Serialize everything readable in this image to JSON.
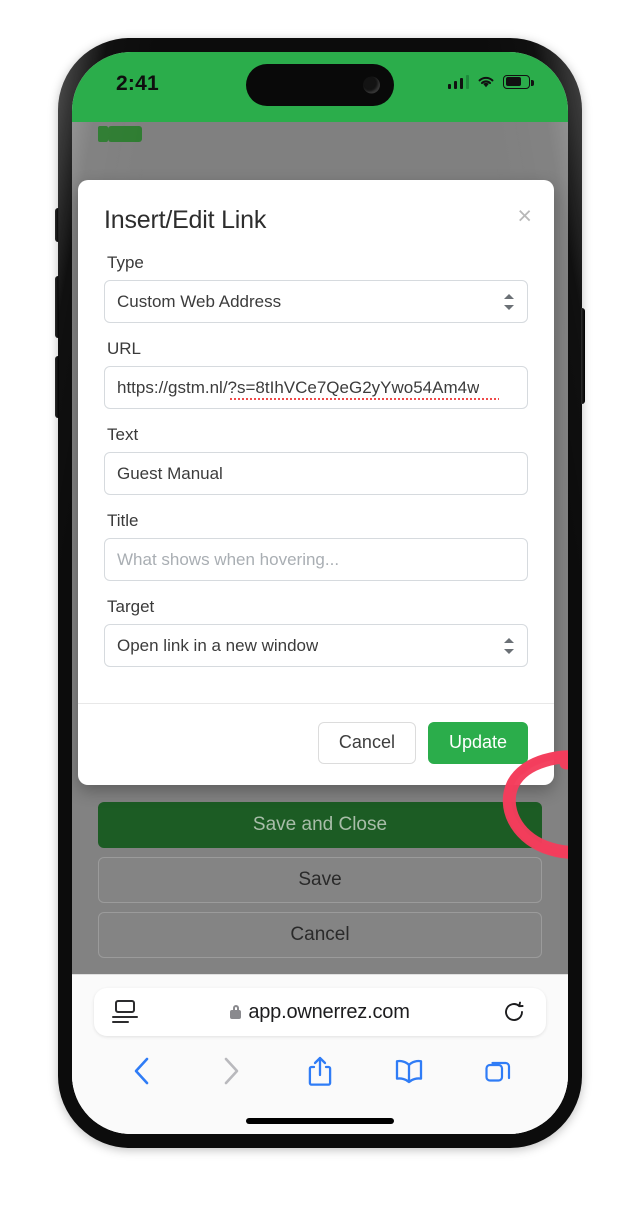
{
  "device": {
    "status_bar": {
      "time": "2:41",
      "signal_icon": "cellular-signal-icon",
      "wifi_icon": "wifi-icon",
      "battery_icon": "battery-icon",
      "background_color": "#2bad4b"
    },
    "home_indicator": "home-indicator"
  },
  "modal": {
    "title": "Insert/Edit Link",
    "close_label": "×",
    "fields": [
      {
        "label": "Type",
        "type": "select",
        "value": "Custom Web Address",
        "placeholder": ""
      },
      {
        "label": "URL",
        "type": "text",
        "value": "https://gstm.nl/?s=8tIhVCe7QeG2yYwo54Am4w",
        "placeholder": ""
      },
      {
        "label": "Text",
        "type": "text",
        "value": "Guest Manual",
        "placeholder": ""
      },
      {
        "label": "Title",
        "type": "text",
        "value": "",
        "placeholder": "What shows when hovering..."
      },
      {
        "label": "Target",
        "type": "select",
        "value": "Open link in a new window",
        "placeholder": ""
      }
    ],
    "footer": {
      "cancel_label": "Cancel",
      "update_label": "Update",
      "update_color": "#2bad4b"
    }
  },
  "background_page": {
    "buttons": [
      {
        "label": "Save and Close",
        "style": "primary"
      },
      {
        "label": "Save",
        "style": "ghost"
      },
      {
        "label": "Cancel",
        "style": "ghost"
      }
    ]
  },
  "browser": {
    "page_settings_icon": "page-settings-icon",
    "lock_icon": "lock-icon",
    "url": "app.ownerrez.com",
    "reload_icon": "reload-icon",
    "toolbar": [
      {
        "name": "back-button",
        "icon": "chevron-left-icon",
        "enabled": true
      },
      {
        "name": "forward-button",
        "icon": "chevron-right-icon",
        "enabled": false
      },
      {
        "name": "share-button",
        "icon": "share-icon",
        "enabled": true
      },
      {
        "name": "bookmarks-button",
        "icon": "book-icon",
        "enabled": true
      },
      {
        "name": "tabs-button",
        "icon": "tabs-icon",
        "enabled": true
      }
    ],
    "accent_color": "#2f7cf6"
  },
  "annotation": {
    "type": "hand-drawn-ellipse",
    "color": "#f43d5c",
    "targets": "update-button"
  }
}
